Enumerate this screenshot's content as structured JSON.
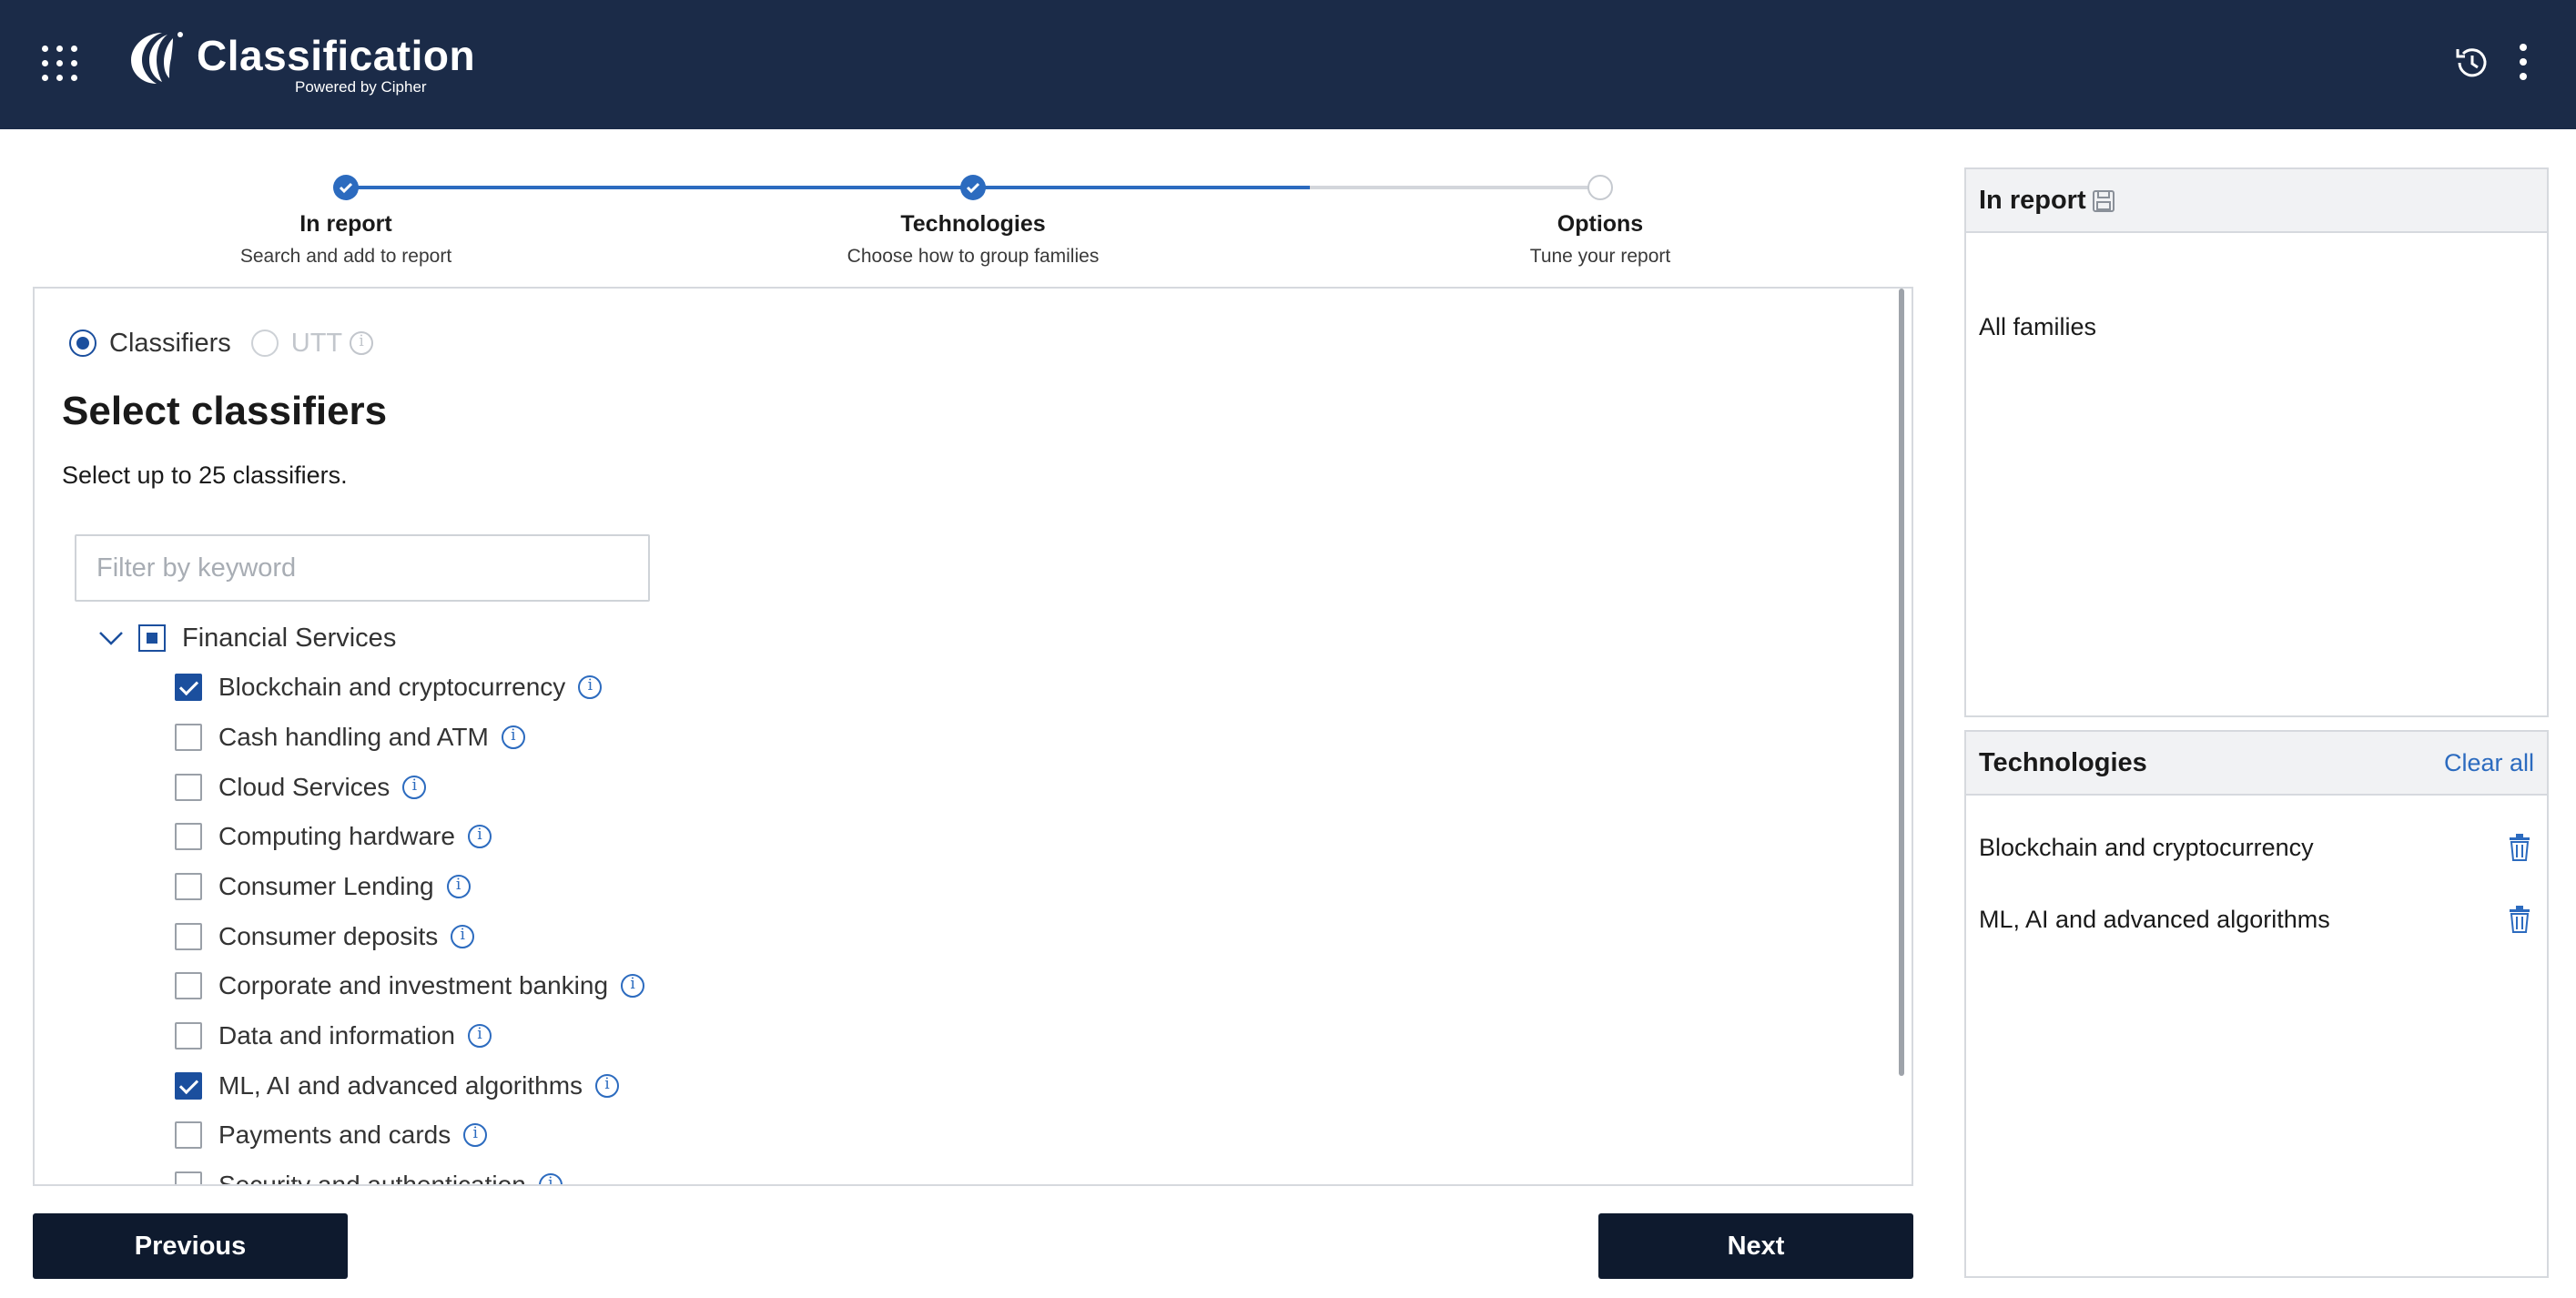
{
  "header": {
    "brand": "Classification",
    "brand_sub": "Powered by Cipher",
    "icons": [
      "apps-grid-icon",
      "logo-icon",
      "history-icon",
      "more-vert-icon"
    ]
  },
  "stepper": {
    "steps": [
      {
        "title": "In report",
        "subtitle": "Search and add to report",
        "state": "done"
      },
      {
        "title": "Technologies",
        "subtitle": "Choose how to group families",
        "state": "done"
      },
      {
        "title": "Options",
        "subtitle": "Tune your report",
        "state": "todo"
      }
    ]
  },
  "main": {
    "radio_classifiers": "Classifiers",
    "radio_utt": "UTT",
    "title": "Select classifiers",
    "description": "Select up to 25 classifiers.",
    "filter_placeholder": "Filter by keyword",
    "filter_value": "",
    "group": {
      "label": "Financial Services",
      "state": "partial",
      "expanded": true
    },
    "items": [
      {
        "label": "Blockchain and cryptocurrency",
        "checked": true
      },
      {
        "label": "Cash handling and ATM",
        "checked": false
      },
      {
        "label": "Cloud Services",
        "checked": false
      },
      {
        "label": "Computing hardware",
        "checked": false
      },
      {
        "label": "Consumer Lending",
        "checked": false
      },
      {
        "label": "Consumer deposits",
        "checked": false
      },
      {
        "label": "Corporate and investment banking",
        "checked": false
      },
      {
        "label": "Data and information",
        "checked": false
      },
      {
        "label": "ML, AI and advanced algorithms",
        "checked": true
      },
      {
        "label": "Payments and cards",
        "checked": false
      },
      {
        "label": "Security and authentication",
        "checked": false
      }
    ]
  },
  "buttons": {
    "previous": "Previous",
    "next": "Next"
  },
  "side": {
    "in_report": {
      "title": "In report",
      "content": "All families"
    },
    "technologies": {
      "title": "Technologies",
      "clear_all": "Clear all",
      "items": [
        "Blockchain and cryptocurrency",
        "ML, AI and advanced algorithms"
      ]
    }
  },
  "colors": {
    "header_bg": "#1b2b48",
    "accent": "#2c6bbf",
    "checkbox_on": "#1b4f9e",
    "button_bg": "#0e1a2e"
  }
}
